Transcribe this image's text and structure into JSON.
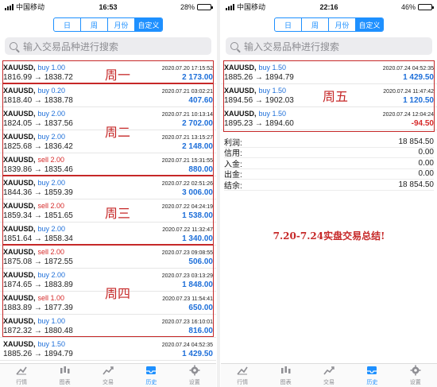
{
  "left": {
    "status": {
      "carrier": "中国移动",
      "time": "16:53",
      "battery": "28%",
      "battery_level": 0.28
    },
    "segments": [
      {
        "label": "日",
        "active": false
      },
      {
        "label": "周",
        "active": false
      },
      {
        "label": "月份",
        "active": false
      },
      {
        "label": "自定义",
        "active": true
      }
    ],
    "search_placeholder": "输入交易品种进行搜索",
    "trades": [
      {
        "symbol": "XAUUSD,",
        "side": "buy",
        "volume": "buy 1.00",
        "date": "2020.07.20 17:15:52",
        "prices": "1816.99 → 1838.72",
        "profit": "2 173.00"
      },
      {
        "symbol": "XAUUSD,",
        "side": "buy",
        "volume": "buy 0.20",
        "date": "2020.07.21 03:02:21",
        "prices": "1818.40 → 1838.78",
        "profit": "407.60"
      },
      {
        "symbol": "XAUUSD,",
        "side": "buy",
        "volume": "buy 2.00",
        "date": "2020.07.21 10:13:14",
        "prices": "1824.05 → 1837.56",
        "profit": "2 702.00"
      },
      {
        "symbol": "XAUUSD,",
        "side": "buy",
        "volume": "buy 2.00",
        "date": "2020.07.21 13:15:27",
        "prices": "1825.68 → 1836.42",
        "profit": "2 148.00"
      },
      {
        "symbol": "XAUUSD,",
        "side": "sell",
        "volume": "sell 2.00",
        "date": "2020.07.21 15:31:55",
        "prices": "1839.86 → 1835.46",
        "profit": "880.00"
      },
      {
        "symbol": "XAUUSD,",
        "side": "buy",
        "volume": "buy 2.00",
        "date": "2020.07.22 02:51:26",
        "prices": "1844.36 → 1859.39",
        "profit": "3 006.00"
      },
      {
        "symbol": "XAUUSD,",
        "side": "sell",
        "volume": "sell 2.00",
        "date": "2020.07.22 04:24:19",
        "prices": "1859.34 → 1851.65",
        "profit": "1 538.00"
      },
      {
        "symbol": "XAUUSD,",
        "side": "buy",
        "volume": "buy 2.00",
        "date": "2020.07.22 11:32:47",
        "prices": "1851.64 → 1858.34",
        "profit": "1 340.00"
      },
      {
        "symbol": "XAUUSD,",
        "side": "sell",
        "volume": "sell 2.00",
        "date": "2020.07.23 09:08:55",
        "prices": "1875.08 → 1872.55",
        "profit": "506.00"
      },
      {
        "symbol": "XAUUSD,",
        "side": "buy",
        "volume": "buy 2.00",
        "date": "2020.07.23 03:13:29",
        "prices": "1874.65 → 1883.89",
        "profit": "1 848.00"
      },
      {
        "symbol": "XAUUSD,",
        "side": "sell",
        "volume": "sell 1.00",
        "date": "2020.07.23 11:54:41",
        "prices": "1883.89 → 1877.39",
        "profit": "650.00"
      },
      {
        "symbol": "XAUUSD,",
        "side": "buy",
        "volume": "buy 1.00",
        "date": "2020.07.23 16:10:01",
        "prices": "1872.32 → 1880.48",
        "profit": "816.00"
      },
      {
        "symbol": "XAUUSD,",
        "side": "buy",
        "volume": "buy 1.50",
        "date": "2020.07.24 04:52:35",
        "prices": "1885.26 → 1894.79",
        "profit": "1 429.50"
      }
    ],
    "week_labels": [
      "周一",
      "周二",
      "周三",
      "周四"
    ]
  },
  "right": {
    "status": {
      "carrier": "中国移动",
      "time": "22:16",
      "battery": "46%",
      "battery_level": 0.46
    },
    "segments": [
      {
        "label": "日",
        "active": false
      },
      {
        "label": "周",
        "active": false
      },
      {
        "label": "月份",
        "active": false
      },
      {
        "label": "自定义",
        "active": true
      }
    ],
    "search_placeholder": "输入交易品种进行搜索",
    "trades": [
      {
        "symbol": "XAUUSD,",
        "side": "buy",
        "volume": "buy 1.50",
        "date": "2020.07.24 04:52:35",
        "prices": "1885.26 → 1894.79",
        "profit": "1 429.50"
      },
      {
        "symbol": "XAUUSD,",
        "side": "buy",
        "volume": "buy 1.50",
        "date": "2020.07.24 11:47:42",
        "prices": "1894.56 → 1902.03",
        "profit": "1 120.50"
      },
      {
        "symbol": "XAUUSD,",
        "side": "buy",
        "volume": "buy 1.50",
        "date": "2020.07.24 12:04:24",
        "prices": "1895.23 → 1894.60",
        "profit": "-94.50"
      }
    ],
    "week_label": "周五",
    "summary": [
      {
        "label": "利润:",
        "value": "18 854.50"
      },
      {
        "label": "信用:",
        "value": "0.00"
      },
      {
        "label": "入金:",
        "value": "0.00"
      },
      {
        "label": "出金:",
        "value": "0.00"
      },
      {
        "label": "结余:",
        "value": "18 854.50"
      }
    ],
    "conclusion": "7.20-7.24实盘交易总结!"
  },
  "tabbar": [
    {
      "label": "行情",
      "icon": "quotes-icon",
      "active": false
    },
    {
      "label": "图表",
      "icon": "chart-icon",
      "active": false
    },
    {
      "label": "交易",
      "icon": "trade-icon",
      "active": false
    },
    {
      "label": "历史",
      "icon": "history-icon",
      "active": true
    },
    {
      "label": "设置",
      "icon": "settings-icon",
      "active": false
    }
  ],
  "colors": {
    "accent": "#1e90ff",
    "buy": "#1e6fd9",
    "sell": "#d62a2a",
    "annotation": "#c62828"
  }
}
